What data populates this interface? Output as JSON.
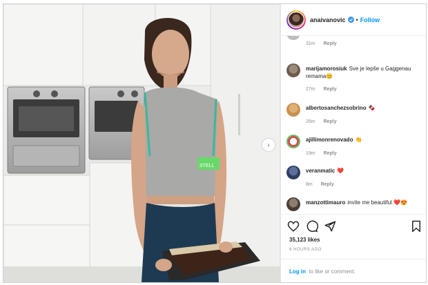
{
  "post": {
    "username": "anaivanovic",
    "follow_label": "Follow",
    "dot": "•",
    "top_comment_meta": {
      "time": "31m",
      "reply": "Reply"
    },
    "comments": [
      {
        "user": "marijamorosiuk",
        "text": "Sve je lepše u Gaggenau remama😊",
        "time": "27m",
        "reply": "Reply"
      },
      {
        "user": "albertosanchezsobrino",
        "text": "🍫",
        "time": "26m",
        "reply": "Reply"
      },
      {
        "user": "ajillimonrenovado",
        "text": "👏",
        "time": "19m",
        "reply": "Reply"
      },
      {
        "user": "veranmatic",
        "text": "❤️",
        "time": "8m",
        "reply": "Reply"
      },
      {
        "user": "manzottimauro",
        "text": "invite me beautiful ❤️😍",
        "time": "",
        "reply": ""
      }
    ],
    "likes": "35,123 likes",
    "posted_ago": "6 HOURS AGO",
    "login_link": "Log in",
    "login_rest": "to like or comment.",
    "shirt_text": "STELL"
  },
  "icons": [
    "heart-icon",
    "comment-icon",
    "share-icon",
    "bookmark-icon",
    "verified-icon",
    "chevron-right-icon"
  ],
  "colors": {
    "accent": "#0095f6",
    "text": "#262626",
    "muted": "#8e8e8e"
  }
}
